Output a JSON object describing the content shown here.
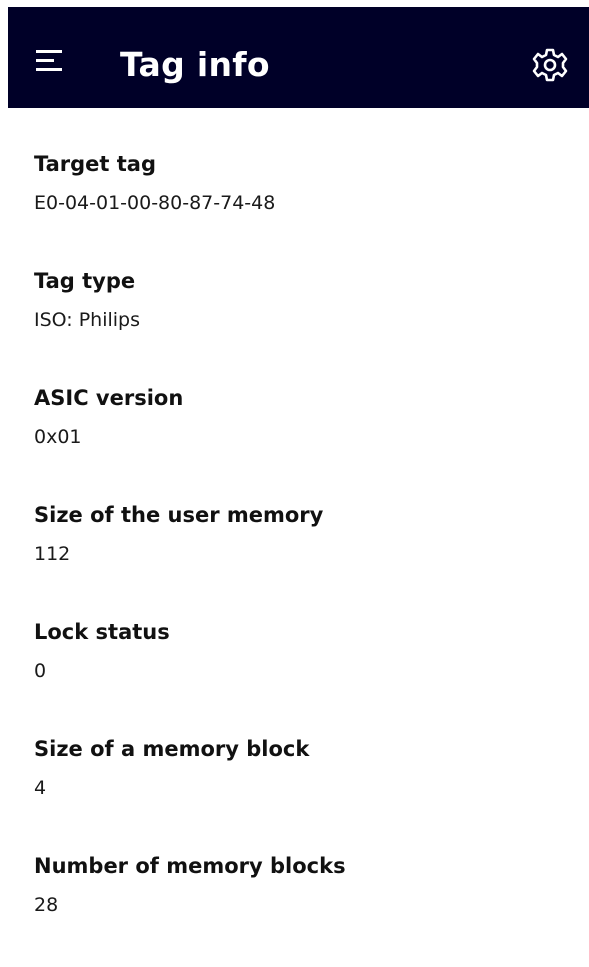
{
  "header": {
    "title": "Tag info",
    "menu_icon": "hamburger-menu-icon",
    "settings_icon": "gear-icon",
    "background_color": "#000028"
  },
  "fields": [
    {
      "label": "Target tag",
      "value": "E0-04-01-00-80-87-74-48"
    },
    {
      "label": "Tag type",
      "value": "ISO: Philips"
    },
    {
      "label": "ASIC version",
      "value": "0x01"
    },
    {
      "label": "Size of the user memory",
      "value": "112"
    },
    {
      "label": "Lock status",
      "value": "0"
    },
    {
      "label": "Size of a memory block",
      "value": "4"
    },
    {
      "label": "Number of memory blocks",
      "value": "28"
    }
  ]
}
